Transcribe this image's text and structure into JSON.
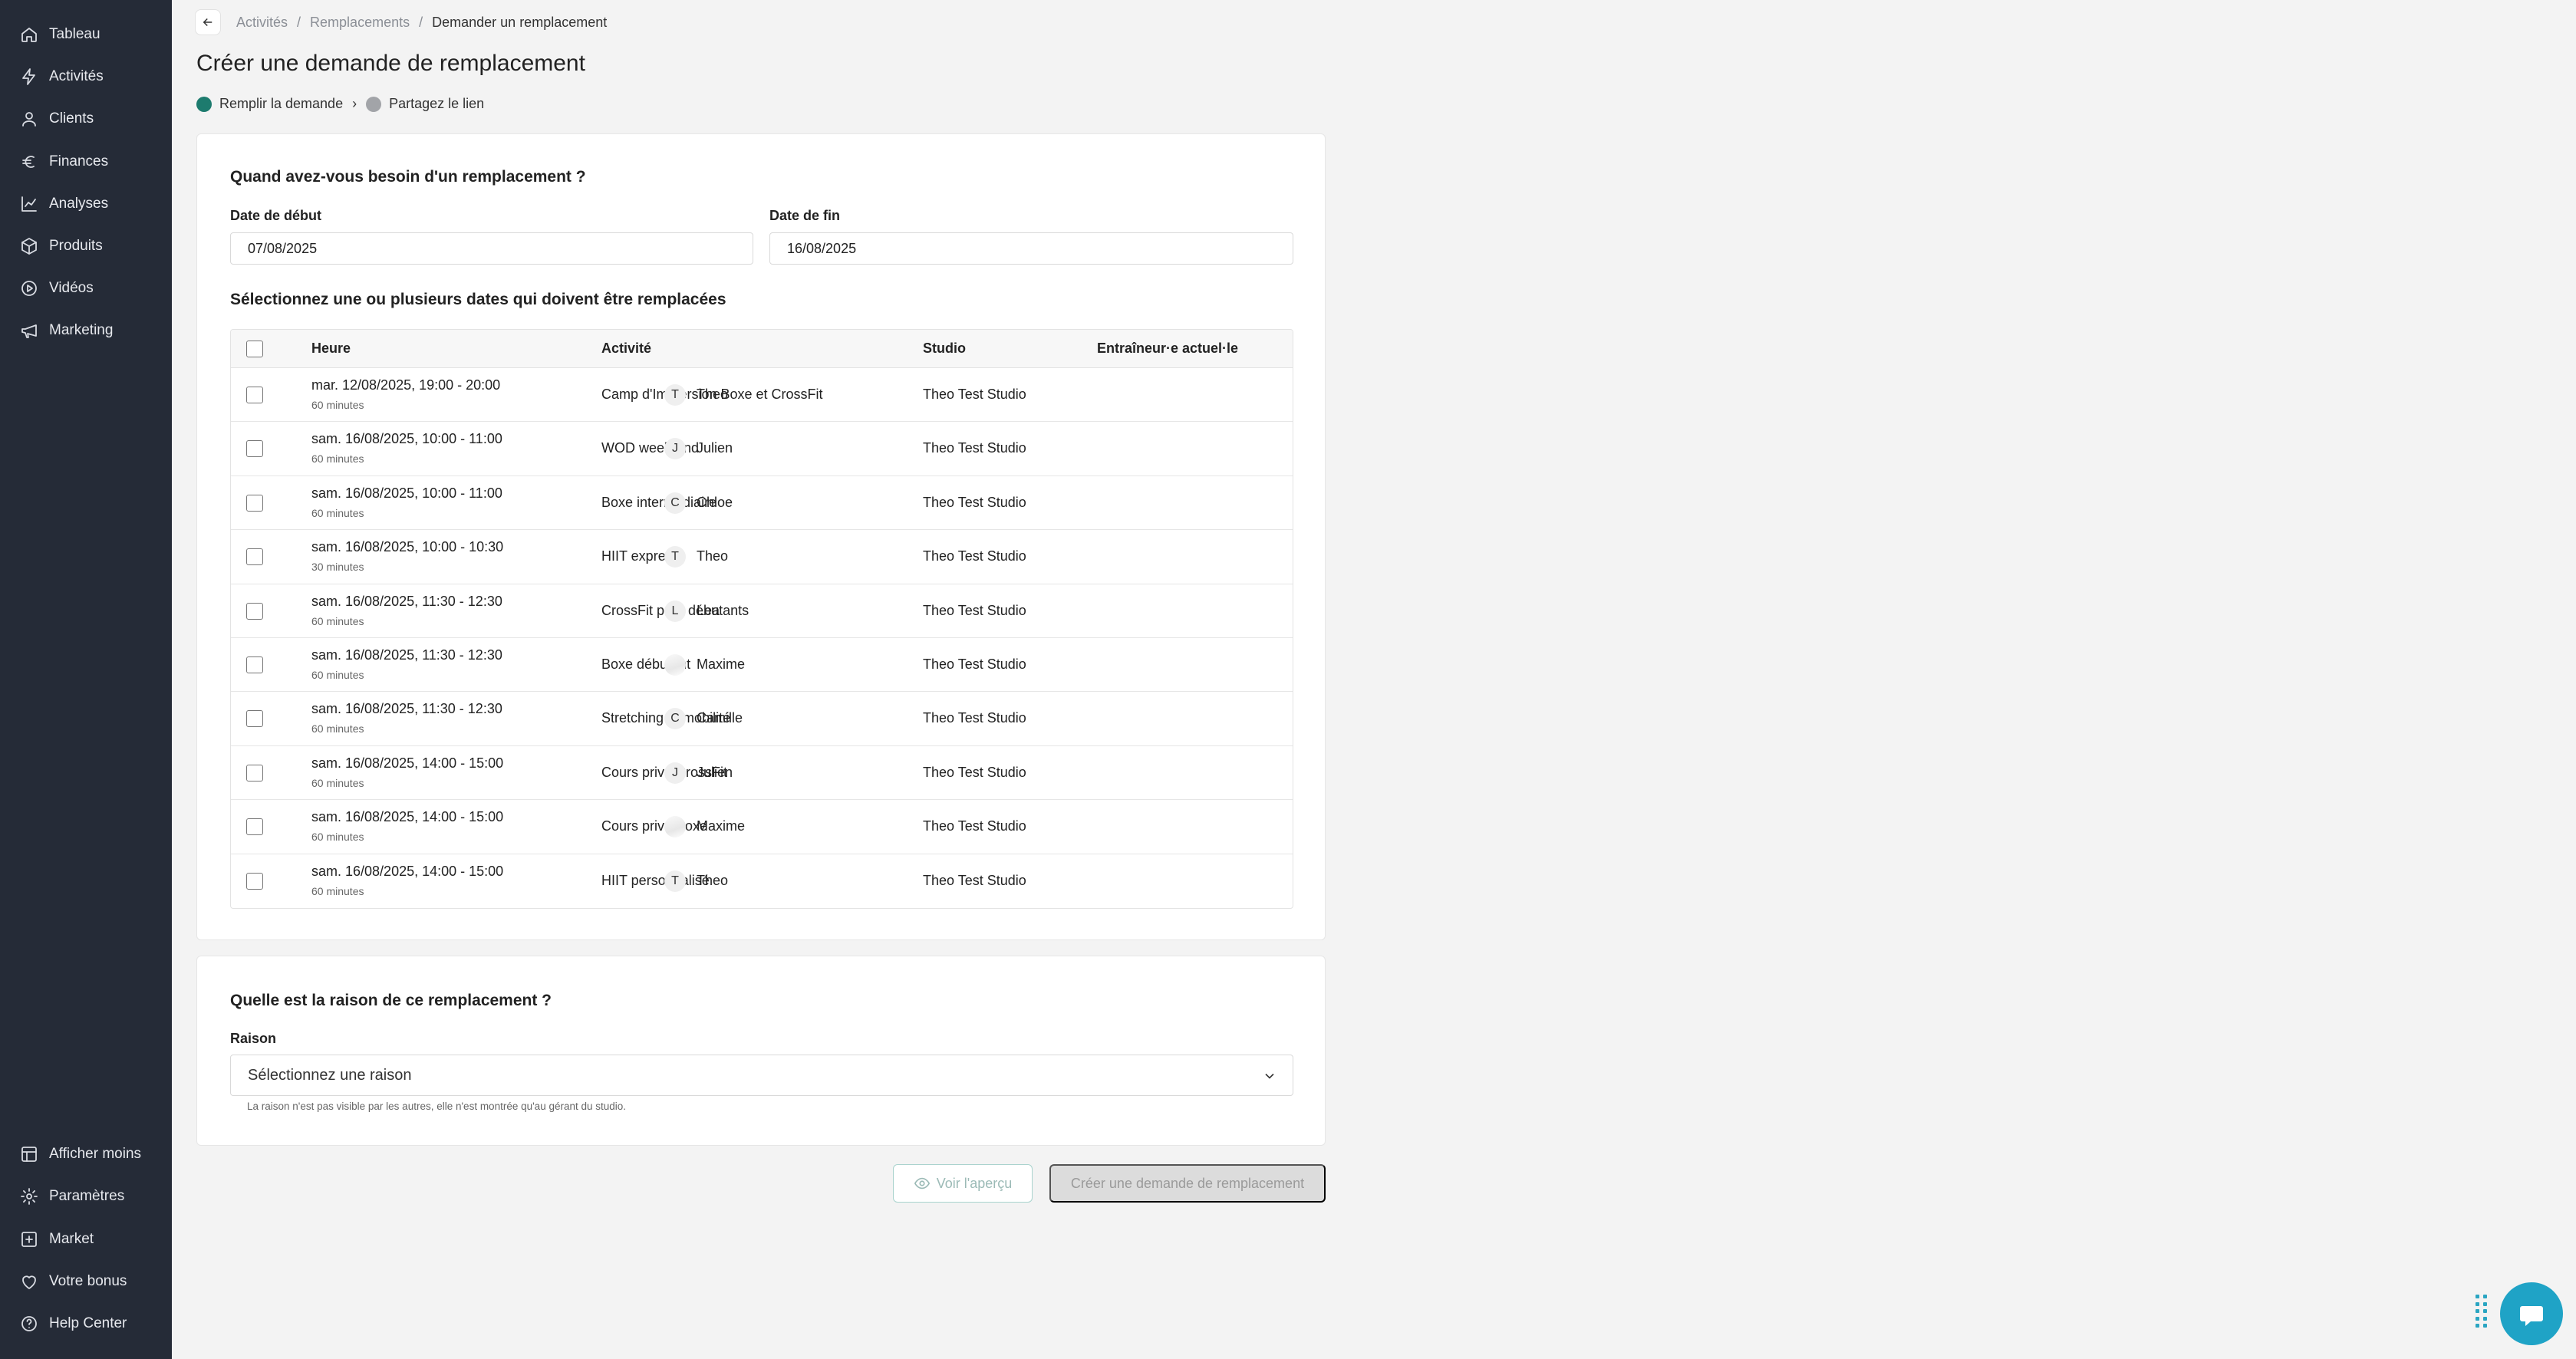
{
  "sidebar": {
    "top_items": [
      {
        "label": "Tableau",
        "icon": "home-icon"
      },
      {
        "label": "Activités",
        "icon": "activity-icon"
      },
      {
        "label": "Clients",
        "icon": "user-icon"
      },
      {
        "label": "Finances",
        "icon": "euro-icon"
      },
      {
        "label": "Analyses",
        "icon": "chart-icon"
      },
      {
        "label": "Produits",
        "icon": "box-icon"
      },
      {
        "label": "Vidéos",
        "icon": "play-icon"
      },
      {
        "label": "Marketing",
        "icon": "megaphone-icon"
      }
    ],
    "bottom_items": [
      {
        "label": "Afficher moins",
        "icon": "collapse-icon"
      },
      {
        "label": "Paramètres",
        "icon": "gear-icon"
      },
      {
        "label": "Market",
        "icon": "plus-square-icon"
      },
      {
        "label": "Votre bonus",
        "icon": "heart-icon"
      },
      {
        "label": "Help Center",
        "icon": "help-icon"
      }
    ]
  },
  "breadcrumb": {
    "items": [
      "Activités",
      "Remplacements"
    ],
    "separator": "/",
    "current": "Demander un remplacement"
  },
  "page_title": "Créer une demande de remplacement",
  "steps": [
    {
      "label": "Remplir la demande",
      "state": "active"
    },
    {
      "label": "Partagez le lien",
      "state": "inactive"
    }
  ],
  "step_separator": "›",
  "when": {
    "title": "Quand avez-vous besoin d'un remplacement ?",
    "start_label": "Date de début",
    "start_value": "07/08/2025",
    "end_label": "Date de fin",
    "end_value": "16/08/2025"
  },
  "table": {
    "title": "Sélectionnez une ou plusieurs dates qui doivent être remplacées",
    "headers": {
      "time": "Heure",
      "activity": "Activité",
      "studio": "Studio",
      "trainer": "Entraîneur·e actuel·le"
    },
    "rows": [
      {
        "time": "mar. 12/08/2025, 19:00 - 20:00",
        "duration": "60 minutes",
        "activity": "Camp d'Immersion Boxe et CrossFit",
        "studio": "Theo Test Studio",
        "initial": "T",
        "trainer": "Theo"
      },
      {
        "time": "sam. 16/08/2025, 10:00 - 11:00",
        "duration": "60 minutes",
        "activity": "WOD week-end",
        "studio": "Theo Test Studio",
        "initial": "J",
        "trainer": "Julien"
      },
      {
        "time": "sam. 16/08/2025, 10:00 - 11:00",
        "duration": "60 minutes",
        "activity": "Boxe intermédiaire",
        "studio": "Theo Test Studio",
        "initial": "C",
        "trainer": "Chloe"
      },
      {
        "time": "sam. 16/08/2025, 10:00 - 10:30",
        "duration": "30 minutes",
        "activity": "HIIT express",
        "studio": "Theo Test Studio",
        "initial": "T",
        "trainer": "Theo"
      },
      {
        "time": "sam. 16/08/2025, 11:30 - 12:30",
        "duration": "60 minutes",
        "activity": "CrossFit pour débutants",
        "studio": "Theo Test Studio",
        "initial": "L",
        "trainer": "Lea"
      },
      {
        "time": "sam. 16/08/2025, 11:30 - 12:30",
        "duration": "60 minutes",
        "activity": "Boxe débutant",
        "studio": "Theo Test Studio",
        "initial": "",
        "trainer": "Maxime"
      },
      {
        "time": "sam. 16/08/2025, 11:30 - 12:30",
        "duration": "60 minutes",
        "activity": "Stretching et mobilité",
        "studio": "Theo Test Studio",
        "initial": "C",
        "trainer": "Camille"
      },
      {
        "time": "sam. 16/08/2025, 14:00 - 15:00",
        "duration": "60 minutes",
        "activity": "Cours privé CrossFit",
        "studio": "Theo Test Studio",
        "initial": "J",
        "trainer": "Julien"
      },
      {
        "time": "sam. 16/08/2025, 14:00 - 15:00",
        "duration": "60 minutes",
        "activity": "Cours privé Boxe",
        "studio": "Theo Test Studio",
        "initial": "",
        "trainer": "Maxime"
      },
      {
        "time": "sam. 16/08/2025, 14:00 - 15:00",
        "duration": "60 minutes",
        "activity": "HIIT personnalisé",
        "studio": "Theo Test Studio",
        "initial": "T",
        "trainer": "Theo"
      }
    ]
  },
  "reason": {
    "title": "Quelle est la raison de ce remplacement ?",
    "label": "Raison",
    "placeholder": "Sélectionnez une raison",
    "hint": "La raison n'est pas visible par les autres, elle n'est montrée qu'au gérant du studio."
  },
  "actions": {
    "preview_label": "Voir l'aperçu",
    "create_label": "Créer une demande de remplacement"
  },
  "colors": {
    "sidebar": "#252b37",
    "accent": "#1d7b6e",
    "chat": "#1fa3c6"
  }
}
